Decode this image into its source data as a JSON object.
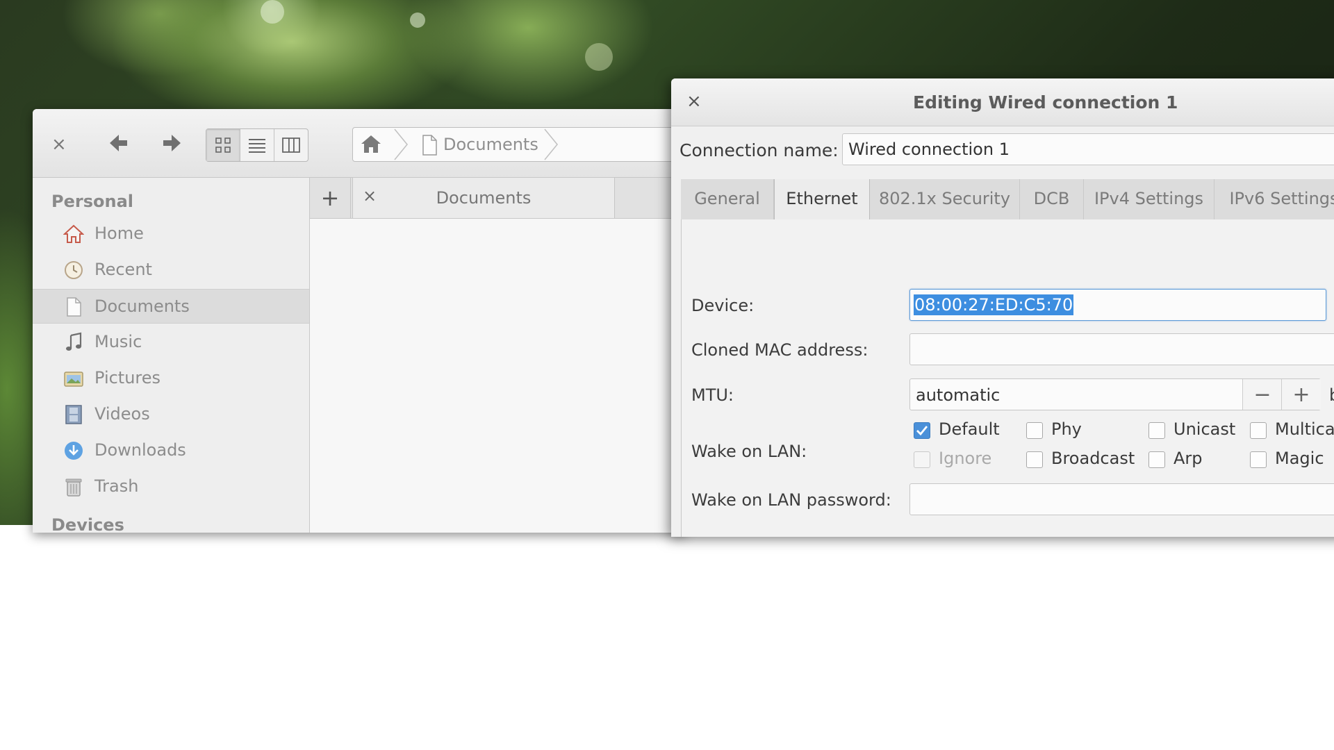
{
  "file_manager": {
    "breadcrumb": {
      "current": "Documents"
    },
    "sidebar": {
      "heading": "Personal",
      "items": [
        {
          "label": "Home",
          "icon": "home-icon"
        },
        {
          "label": "Recent",
          "icon": "clock-icon"
        },
        {
          "label": "Documents",
          "icon": "document-icon",
          "active": true
        },
        {
          "label": "Music",
          "icon": "music-note-icon"
        },
        {
          "label": "Pictures",
          "icon": "pictures-icon"
        },
        {
          "label": "Videos",
          "icon": "film-icon"
        },
        {
          "label": "Downloads",
          "icon": "download-icon"
        },
        {
          "label": "Trash",
          "icon": "trash-icon"
        }
      ],
      "next_heading": "Devices"
    },
    "tabs": {
      "new_tab_glyph": "+",
      "close_glyph": "×",
      "items": [
        {
          "label": "Documents"
        }
      ]
    },
    "toolbar": {
      "close_glyph": "×",
      "back_glyph": "🡐",
      "forward_glyph": "🡒"
    }
  },
  "dialog": {
    "title": "Editing Wired connection 1",
    "close_glyph": "×",
    "connection_name_label": "Connection name:",
    "connection_name_value": "Wired connection 1",
    "tabs": [
      {
        "label": "General"
      },
      {
        "label": "Ethernet",
        "active": true
      },
      {
        "label": "802.1x Security"
      },
      {
        "label": "DCB"
      },
      {
        "label": "IPv4 Settings"
      },
      {
        "label": "IPv6 Settings"
      }
    ],
    "ethernet": {
      "device_label": "Device:",
      "device_value": "08:00:27:ED:C5:70",
      "cloned_mac_label": "Cloned MAC address:",
      "cloned_mac_value": "",
      "mtu_label": "MTU:",
      "mtu_value": "automatic",
      "mtu_minus": "−",
      "mtu_plus": "+",
      "mtu_unit_partial": "b",
      "wol_label": "Wake on LAN:",
      "wol_options": [
        {
          "label": "Default",
          "checked": true,
          "enabled": true
        },
        {
          "label": "Phy",
          "checked": false,
          "enabled": true
        },
        {
          "label": "Unicast",
          "checked": false,
          "enabled": true
        },
        {
          "label": "Multica",
          "checked": false,
          "enabled": true
        },
        {
          "label": "Ignore",
          "checked": false,
          "enabled": false
        },
        {
          "label": "Broadcast",
          "checked": false,
          "enabled": true
        },
        {
          "label": "Arp",
          "checked": false,
          "enabled": true
        },
        {
          "label": "Magic",
          "checked": false,
          "enabled": true
        }
      ],
      "wol_password_label": "Wake on LAN password:",
      "wol_password_value": ""
    }
  },
  "colors": {
    "accent": "#4a90d9",
    "selection": "#3d8ee0"
  }
}
